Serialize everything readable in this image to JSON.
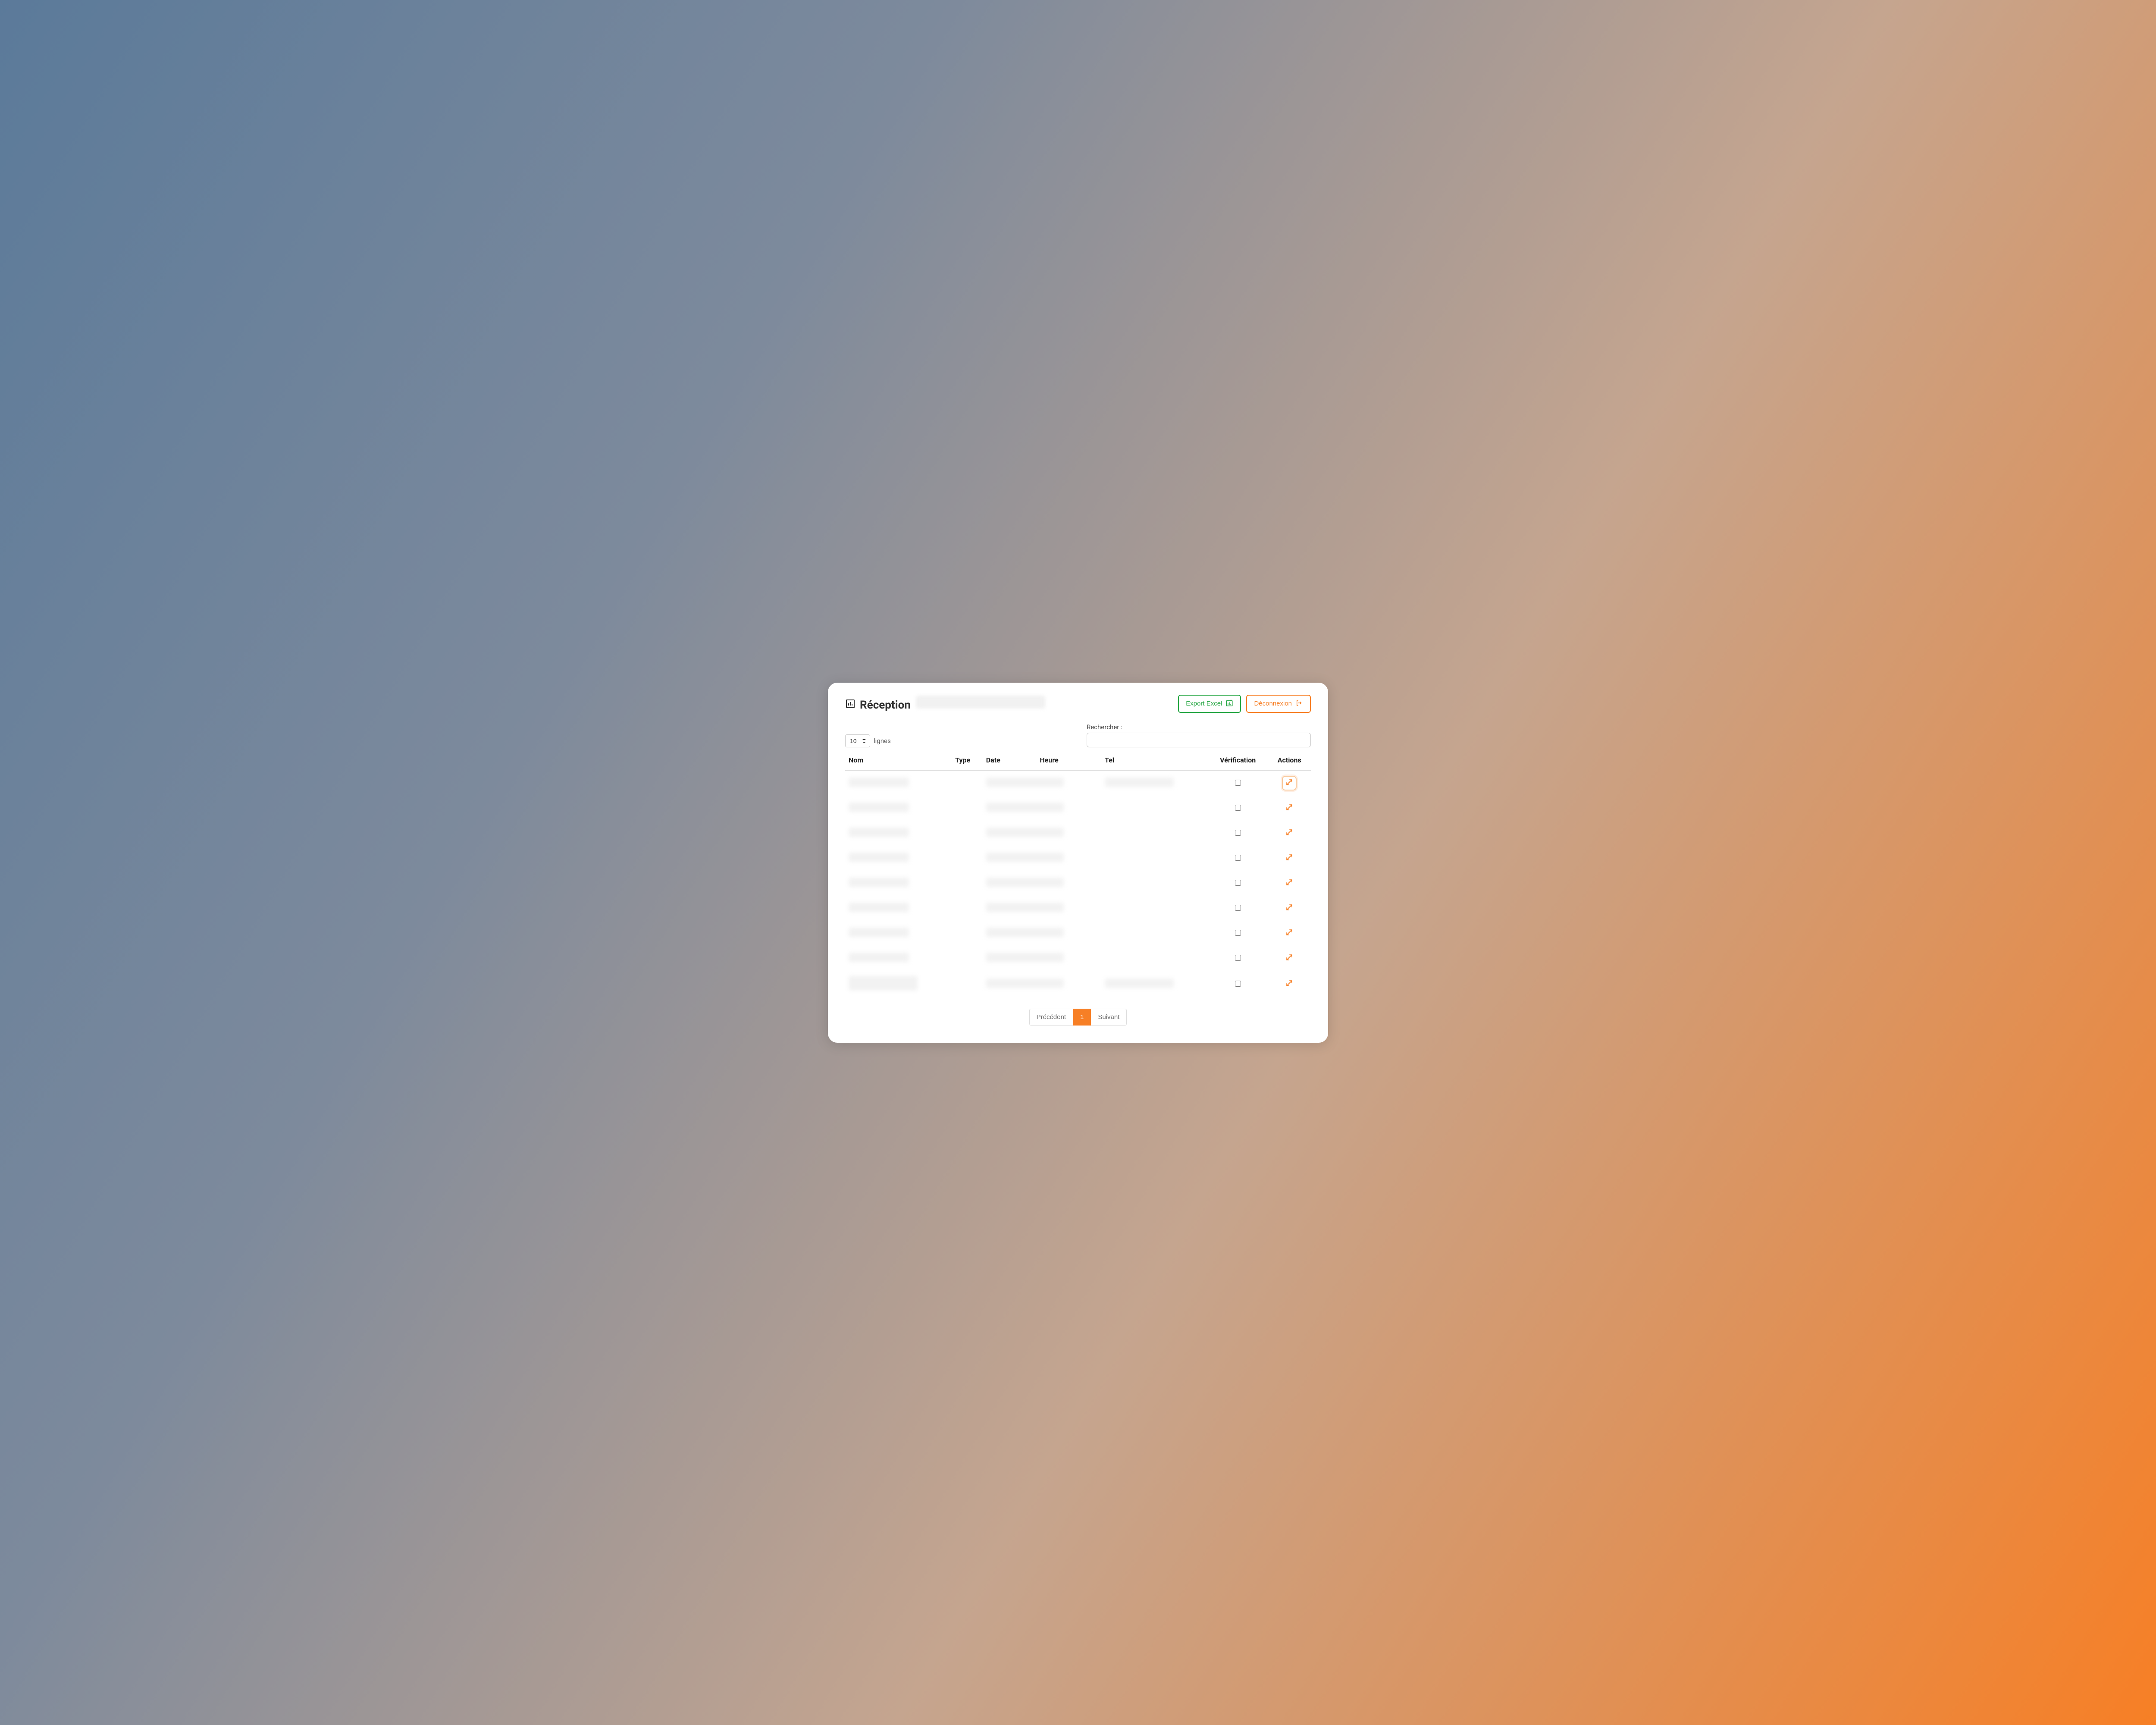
{
  "colors": {
    "accent": "#f77f25",
    "success": "#28a745"
  },
  "header": {
    "title": "Réception",
    "actions": {
      "export_label": "Export Excel",
      "logout_label": "Déconnexion"
    }
  },
  "controls": {
    "length_value": "10",
    "length_suffix": "lignes",
    "search_label": "Rechercher :",
    "search_value": ""
  },
  "table": {
    "columns": {
      "nom": "Nom",
      "type": "Type",
      "date": "Date",
      "heure": "Heure",
      "tel": "Tel",
      "verification": "Vérification",
      "actions": "Actions"
    },
    "rows": [
      {
        "verification": false,
        "action_focused": true,
        "tel_visible": true
      },
      {
        "verification": false,
        "action_focused": false,
        "tel_visible": false
      },
      {
        "verification": false,
        "action_focused": false,
        "tel_visible": false
      },
      {
        "verification": false,
        "action_focused": false,
        "tel_visible": false
      },
      {
        "verification": false,
        "action_focused": false,
        "tel_visible": false
      },
      {
        "verification": false,
        "action_focused": false,
        "tel_visible": false
      },
      {
        "verification": false,
        "action_focused": false,
        "tel_visible": false
      },
      {
        "verification": false,
        "action_focused": false,
        "tel_visible": false
      },
      {
        "verification": false,
        "action_focused": false,
        "tel_visible": true,
        "nom_wide": true
      }
    ]
  },
  "pagination": {
    "prev_label": "Précédent",
    "next_label": "Suivant",
    "current_page": "1"
  }
}
